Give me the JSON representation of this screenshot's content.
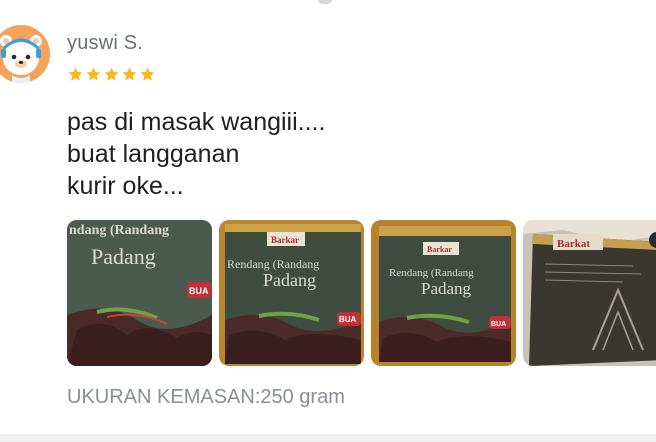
{
  "review": {
    "reviewer_name": "yuswi S.",
    "rating": 5,
    "rating_max": 5,
    "star_color": "#f6b81a",
    "text_lines": [
      "pas di masak wangiii....",
      "buat langganan",
      "kurir oke..."
    ],
    "photos": [
      {
        "icon": "product-photo-pack-front",
        "text_top": "ndang (Randang",
        "text_main": "Padang",
        "badge": "BUA"
      },
      {
        "icon": "product-photo-pack-front",
        "brand": "Barkar",
        "text_top": "Rendang (Randang",
        "text_main": "Padang",
        "badge": "BUA"
      },
      {
        "icon": "product-photo-pack-front",
        "brand": "Barkar",
        "text_top": "Rendang (Randang",
        "text_main": "Padang",
        "badge": "BUA"
      },
      {
        "icon": "product-photo-pack-back",
        "brand": "Barkat"
      }
    ],
    "variant": "UKURAN KEMASAN:250 gram"
  },
  "colors": {
    "avatar_bg": "#f5a35a",
    "name": "#6a6f75",
    "body_text": "#1f1f1f",
    "variant_text": "#8a8f96"
  }
}
